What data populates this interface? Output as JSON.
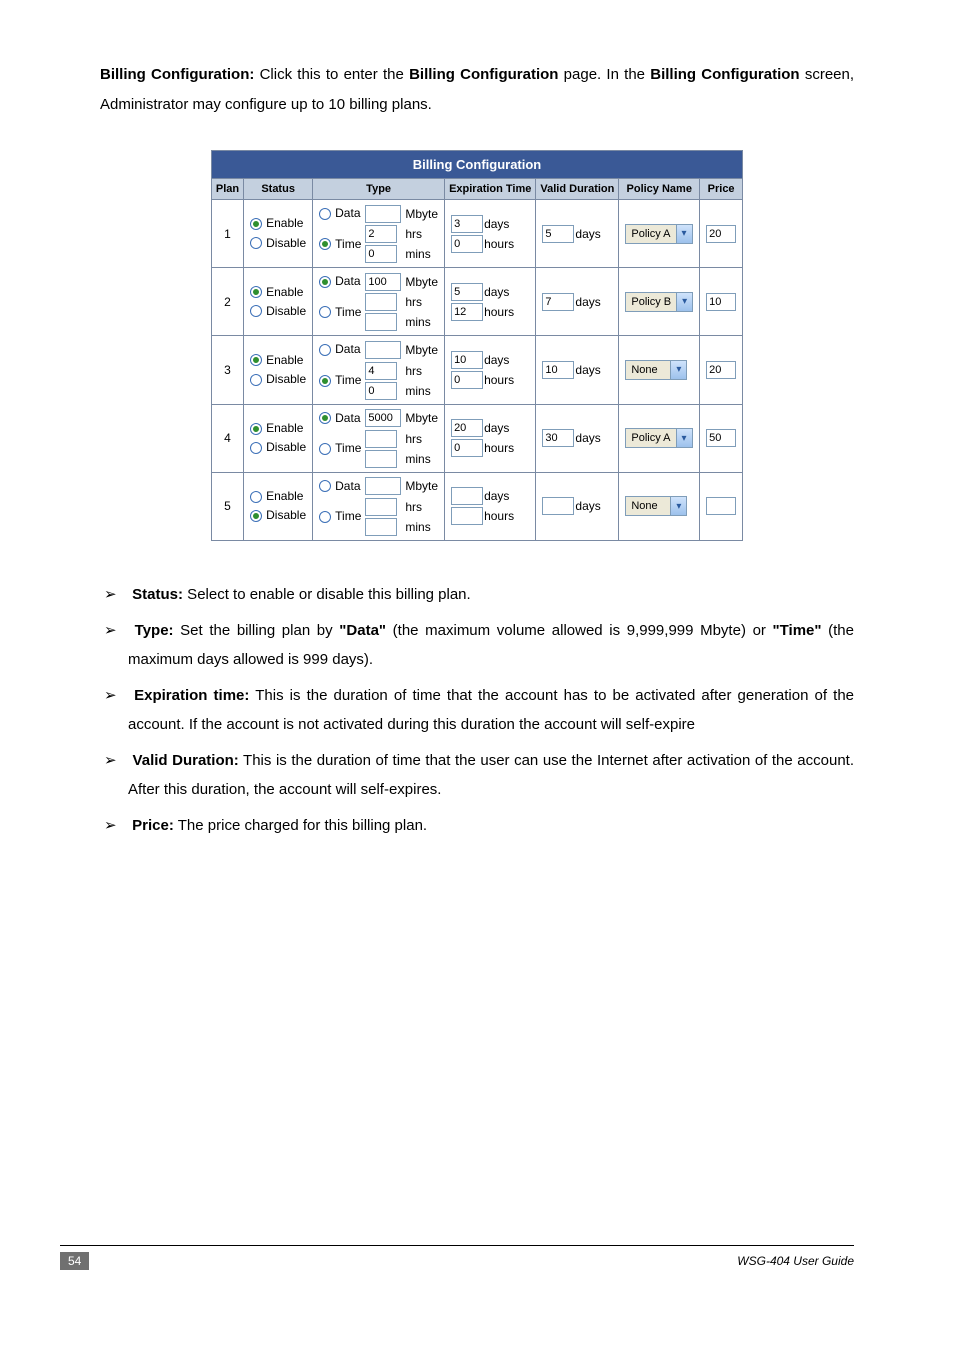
{
  "intro": {
    "lead_bold": "Billing Configuration:",
    "part1": "  Click this to enter the ",
    "bc_bold": "Billing Configuration",
    "part2": " page. In the ",
    "bc2_bold": "Billing Configuration",
    "part3": " screen, Administrator may configure up to 10 billing plans."
  },
  "table": {
    "title": "Billing Configuration",
    "headers": {
      "plan": "Plan",
      "status": "Status",
      "type": "Type",
      "expiration": "Expiration Time",
      "valid": "Valid Duration",
      "policy": "Policy Name",
      "price": "Price"
    },
    "labels": {
      "enable": "Enable",
      "disable": "Disable",
      "data": "Data",
      "time": "Time",
      "mbyte": "Mbyte",
      "hrs": "hrs",
      "mins": "mins",
      "days": "days",
      "hours": "hours"
    },
    "rows": [
      {
        "plan": "1",
        "status": "Enable",
        "type_sel": "Time",
        "mbyte": "",
        "hrs": "2",
        "mins": "0",
        "exp_days": "3",
        "exp_hours": "0",
        "valid_days": "5",
        "policy": "Policy A",
        "price": "20"
      },
      {
        "plan": "2",
        "status": "Enable",
        "type_sel": "Data",
        "mbyte": "100",
        "hrs": "",
        "mins": "",
        "exp_days": "5",
        "exp_hours": "12",
        "valid_days": "7",
        "policy": "Policy B",
        "price": "10"
      },
      {
        "plan": "3",
        "status": "Enable",
        "type_sel": "Time",
        "mbyte": "",
        "hrs": "4",
        "mins": "0",
        "exp_days": "10",
        "exp_hours": "0",
        "valid_days": "10",
        "policy": "None",
        "price": "20"
      },
      {
        "plan": "4",
        "status": "Enable",
        "type_sel": "Data",
        "mbyte": "5000",
        "hrs": "",
        "mins": "",
        "exp_days": "20",
        "exp_hours": "0",
        "valid_days": "30",
        "policy": "Policy A",
        "price": "50"
      },
      {
        "plan": "5",
        "status": "Disable",
        "type_sel": "",
        "mbyte": "",
        "hrs": "",
        "mins": "",
        "exp_days": "",
        "exp_hours": "",
        "valid_days": "",
        "policy": "None",
        "price": ""
      }
    ]
  },
  "bullets": {
    "status_label": "Status:",
    "status_text": " Select to enable or disable this billing plan.",
    "type_label": "Type:",
    "type_text1": " Set the billing plan by ",
    "type_data_bold": "\"Data\"",
    "type_text2": " (the maximum volume allowed is 9,999,999 Mbyte) or ",
    "type_time_bold": "\"Time\"",
    "type_text3": " (the maximum days allowed is 999 days).",
    "exp_label": "Expiration time:",
    "exp_text": " This is the duration of time that the account has to be activated after generation of the account. If the account is not activated during this duration the account will self-expire",
    "valid_label": "Valid Duration:",
    "valid_text": " This is the duration of time that the user can use the Internet after activation of the account. After this duration, the account will self-expires.",
    "price_label": "Price:",
    "price_text": " The price charged for this billing plan."
  },
  "footer": {
    "page": "54",
    "guide": "WSG-404  User Guide"
  }
}
